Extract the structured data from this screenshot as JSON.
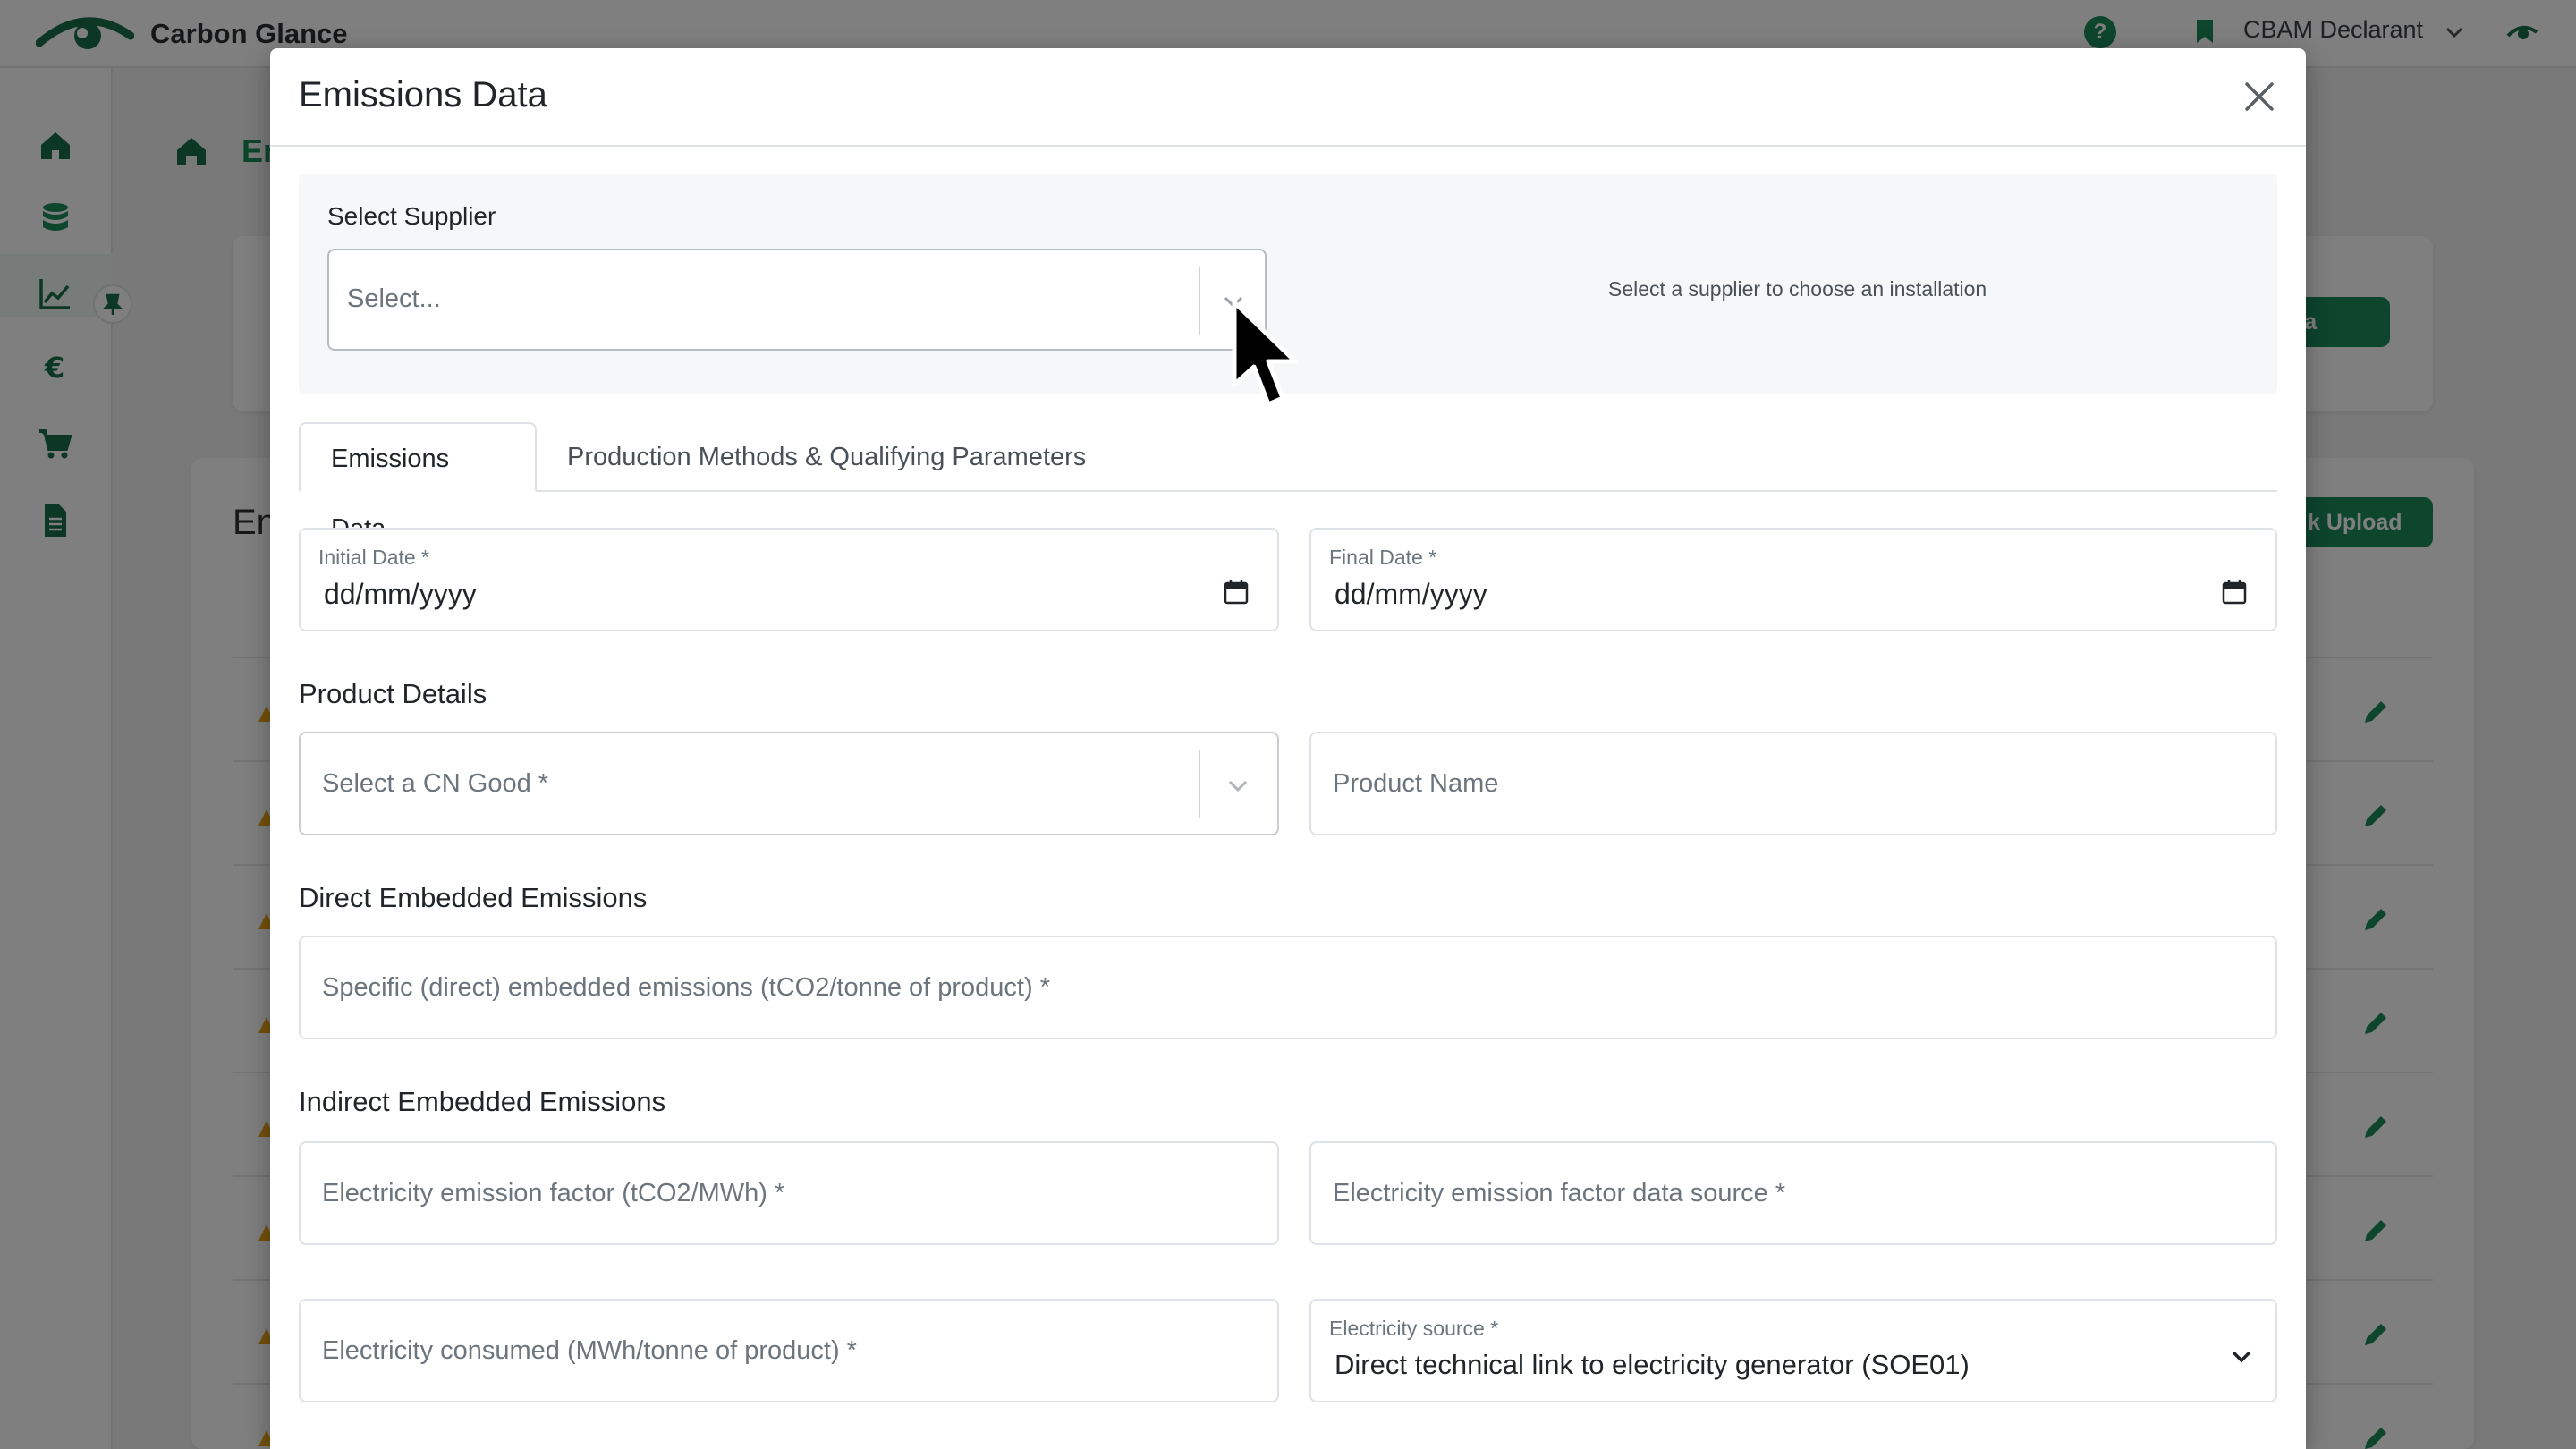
{
  "app": {
    "brand": "Carbon Glance",
    "help_symbol": "?",
    "role_label": "CBAM Declarant",
    "breadcrumb_current": "Em"
  },
  "background": {
    "section_title_fragment": "En",
    "top_button_fragment": "ata",
    "bulk_button_fragment": "k Upload"
  },
  "modal": {
    "title": "Emissions Data",
    "supplier": {
      "label": "Select Supplier",
      "placeholder": "Select...",
      "hint": "Select a supplier to choose an installation"
    },
    "tabs": [
      {
        "label": "Emissions Data",
        "active": true
      },
      {
        "label": "Production Methods & Qualifying Parameters",
        "active": false
      }
    ],
    "initial_date": {
      "label": "Initial Date *",
      "value": "dd/mm/yyyy"
    },
    "final_date": {
      "label": "Final Date *",
      "value": "dd/mm/yyyy"
    },
    "product_details": {
      "heading": "Product Details",
      "cn_good_placeholder": "Select a CN Good *",
      "product_name_placeholder": "Product Name"
    },
    "direct": {
      "heading": "Direct Embedded Emissions",
      "specific_placeholder": "Specific (direct) embedded emissions (tCO2/tonne of product) *"
    },
    "indirect": {
      "heading": "Indirect Embedded Emissions",
      "factor_placeholder": "Electricity emission factor (tCO2/MWh) *",
      "factor_source_placeholder": "Electricity emission factor data source *",
      "consumed_placeholder": "Electricity consumed (MWh/tonne of product) *",
      "source_label": "Electricity source *",
      "source_value": "Direct technical link to electricity generator (SOE01)"
    }
  },
  "colors": {
    "accent": "#1b8a5a",
    "overlay": "rgba(0,0,0,0.5)",
    "warning": "#e8a317"
  },
  "icons": [
    "home-icon",
    "database-icon",
    "chart-icon",
    "euro-icon",
    "cart-icon",
    "document-icon",
    "pin-icon",
    "close-icon",
    "calendar-icon",
    "chevron-down-icon",
    "edit-icon",
    "warning-icon",
    "mouse-cursor"
  ]
}
